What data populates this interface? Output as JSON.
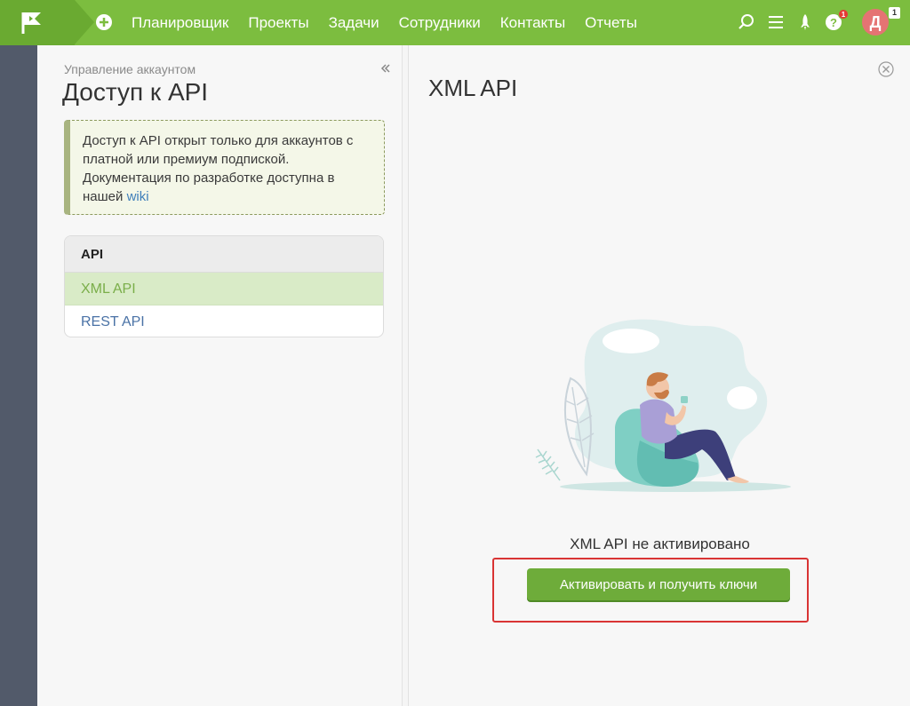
{
  "topbar": {
    "nav": [
      "Планировщик",
      "Проекты",
      "Задачи",
      "Сотрудники",
      "Контакты",
      "Отчеты"
    ],
    "help_badge": "1",
    "avatar_letter": "Д",
    "avatar_badge": "1",
    "icons": [
      "flag-logo-icon",
      "plus-circle-icon",
      "search-icon",
      "menu-icon",
      "rocket-icon",
      "help-icon"
    ],
    "color": "#7cbd3f"
  },
  "left": {
    "breadcrumb": "Управление аккаунтом",
    "title": "Доступ к API",
    "notice_text": "Доступ к API открыт только для аккаунтов с платной или премиум подпиской. Документация по разработке доступна в нашей ",
    "notice_link": "wiki",
    "list_header": "API",
    "items": [
      "XML API",
      "REST API"
    ]
  },
  "right": {
    "title": "XML API",
    "status": "XML API не активировано",
    "button": "Активировать и получить ключи"
  }
}
